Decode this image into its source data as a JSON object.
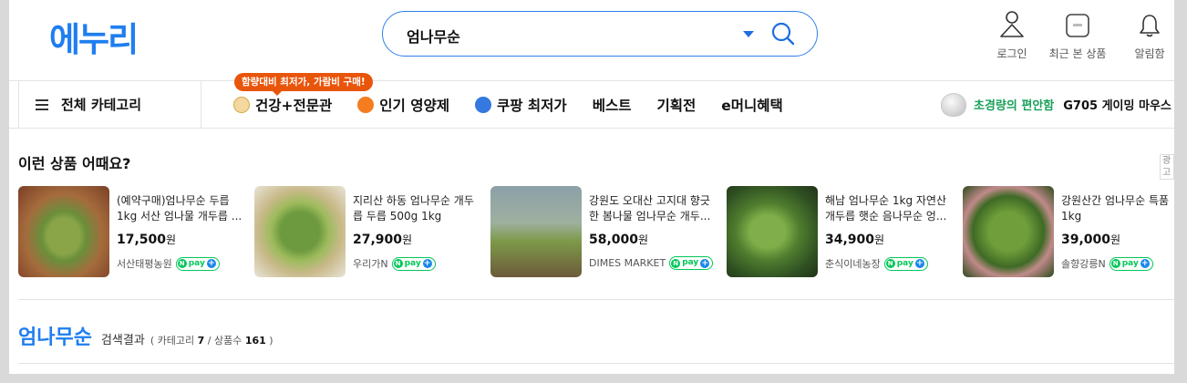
{
  "header": {
    "logo": "에누리",
    "search": {
      "value": "엄나무순"
    },
    "icons": [
      {
        "label": "로그인",
        "icon": "user-icon"
      },
      {
        "label": "최근 본 상품",
        "icon": "recent-view-icon"
      },
      {
        "label": "알림함",
        "icon": "bell-icon"
      }
    ]
  },
  "nav": {
    "category_button": "전체 카테고리",
    "tooltip": "함량대비 최저가, 가람비 구매!",
    "items": [
      {
        "label": "건강+전문관"
      },
      {
        "label": "인기 영양제"
      },
      {
        "label": "쿠팡 최저가"
      },
      {
        "label": "베스트"
      },
      {
        "label": "기획전"
      },
      {
        "label": "e머니혜택"
      }
    ],
    "promo": {
      "highlight": "초경량의 편안함",
      "product": "G705 게이밍 마우스"
    }
  },
  "recommend": {
    "title": "이런 상품 어때요?",
    "ad_label": "광고",
    "pay_label": "pay",
    "cards": [
      {
        "name": "(예약구매)엄나무순 두릅 1kg 서산 엄나물 개두릅 ...",
        "price": "17,500",
        "unit": "원",
        "shop": "서산태평농원"
      },
      {
        "name": "지리산 하동 엄나무순 개두릅 두릅 500g 1kg",
        "price": "27,900",
        "unit": "원",
        "shop": "우리가N"
      },
      {
        "name": "강원도 오대산 고지대 향긋한 봄나물 엄나무순 개두...",
        "price": "58,000",
        "unit": "원",
        "shop": "DIMES MARKET"
      },
      {
        "name": "해남 엄나무순 1kg 자연산 개두릅 햇순 음나무순 엉...",
        "price": "34,900",
        "unit": "원",
        "shop": "춘식이네농장"
      },
      {
        "name": "강원산간 엄나무순 특품 1kg",
        "price": "39,000",
        "unit": "원",
        "shop": "솔향강릉N"
      }
    ]
  },
  "result": {
    "keyword": "엄나무순",
    "label": "검색결과",
    "meta_prefix": "( 카테고리",
    "category_count": "7",
    "meta_mid": "/ 상품수",
    "product_count": "161",
    "meta_suffix": ")"
  }
}
